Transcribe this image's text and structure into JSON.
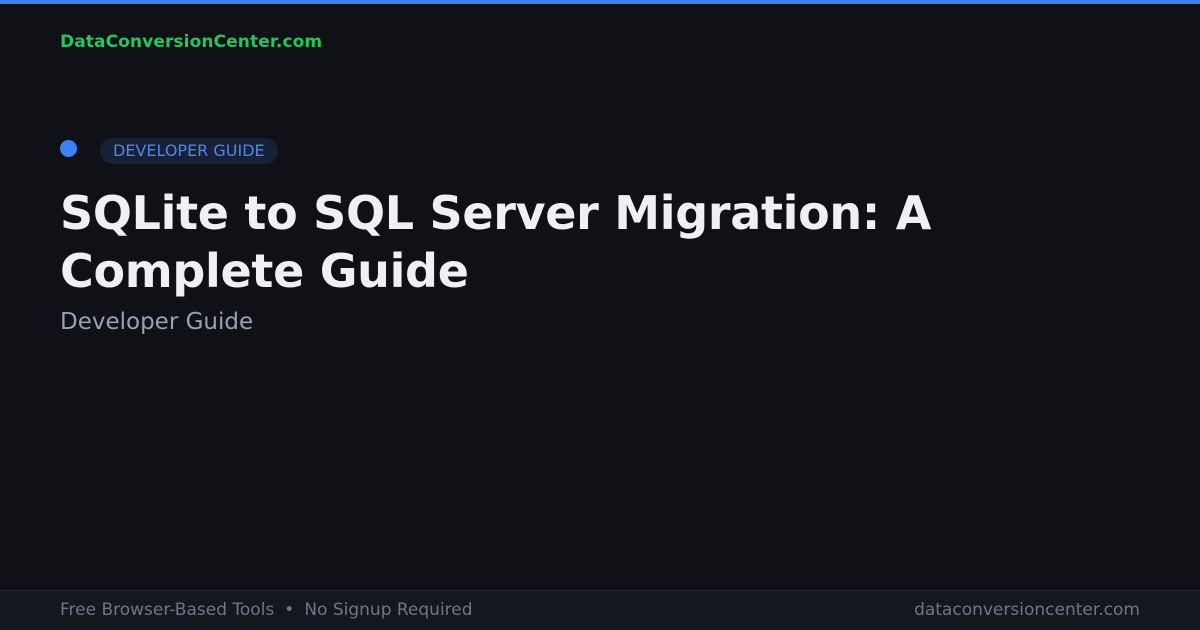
{
  "brand": {
    "name": "DataConversionCenter.com",
    "color": "#22c55e"
  },
  "category": {
    "badge_label": "DEVELOPER GUIDE",
    "dot_color": "#3b82f6"
  },
  "article": {
    "title": "SQLite to SQL Server Migration: A Complete Guide",
    "subtitle": "Developer Guide"
  },
  "footer": {
    "left_item_1": "Free Browser-Based Tools",
    "separator": "•",
    "left_item_2": "No Signup Required",
    "domain": "dataconversioncenter.com"
  },
  "theme": {
    "background": "#0f1116",
    "accent": "#3b82f6"
  }
}
